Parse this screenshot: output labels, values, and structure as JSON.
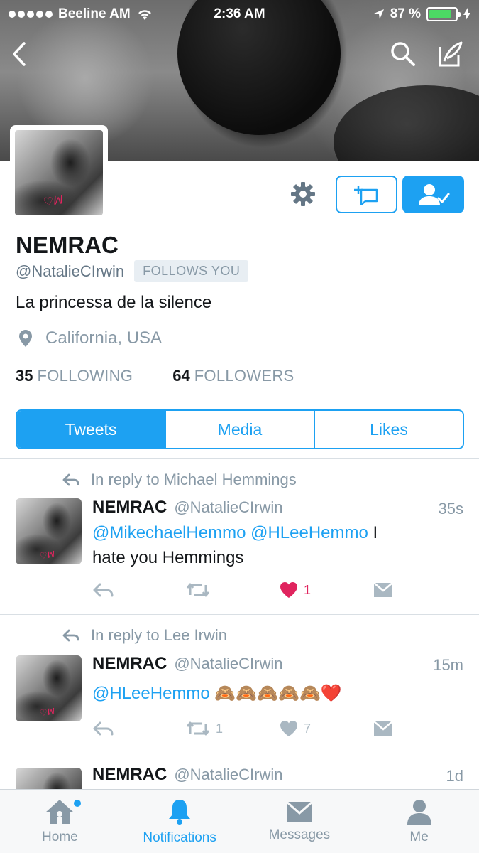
{
  "status_bar": {
    "carrier": "Beeline AM",
    "time": "2:36 AM",
    "battery": "87 %",
    "battery_level": 0.87
  },
  "profile": {
    "name": "NEMRAC",
    "handle": "@NatalieCIrwin",
    "follows_you": "FOLLOWS YOU",
    "bio": "La princessa de la silence",
    "location": "California, USA",
    "following_count": "35",
    "following_label": "FOLLOWING",
    "followers_count": "64",
    "followers_label": "FOLLOWERS"
  },
  "tabs": {
    "tweets": "Tweets",
    "media": "Media",
    "likes": "Likes"
  },
  "tweets": [
    {
      "reply_to": "In reply to Michael Hemmings",
      "name": "NEMRAC",
      "handle": "@NatalieCIrwin",
      "time": "35s",
      "mention1": "@MikechaelHemmo",
      "mention2": "@HLeeHemmo",
      "text_a": " I",
      "text_b": "hate you Hemmings",
      "retweets": "",
      "likes": "1"
    },
    {
      "reply_to": "In reply to Lee Irwin",
      "name": "NEMRAC",
      "handle": "@NatalieCIrwin",
      "time": "15m",
      "mention1": "@HLeeHemmo",
      "emoji": "🙈🙈🙈🙈🙈❤️",
      "retweets": "1",
      "likes": "7"
    },
    {
      "name": "NEMRAC",
      "handle": "@NatalieCIrwin",
      "time": "1d"
    }
  ],
  "tabbar": {
    "home": "Home",
    "notifications": "Notifications",
    "messages": "Messages",
    "me": "Me"
  },
  "colors": {
    "accent": "#1da1f2",
    "like": "#e0245e",
    "muted": "#8899a6"
  }
}
